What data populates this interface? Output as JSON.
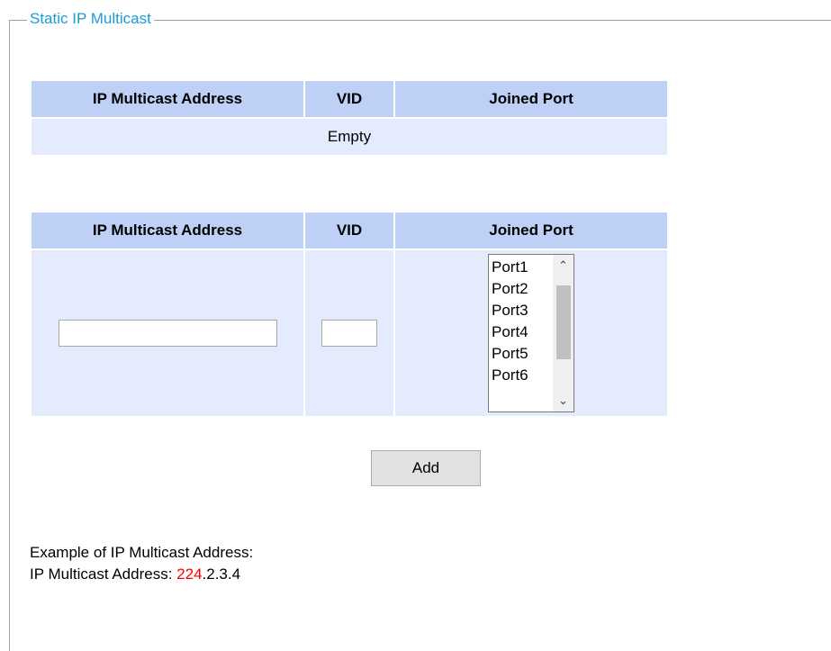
{
  "fieldset": {
    "legend": "Static IP Multicast"
  },
  "table1": {
    "headers": [
      "IP Multicast Address",
      "VID",
      "Joined Port"
    ],
    "empty_text": "Empty"
  },
  "table2": {
    "headers": [
      "IP Multicast Address",
      "VID",
      "Joined Port"
    ],
    "ip_input_value": "",
    "vid_input_value": "",
    "ports": [
      "Port1",
      "Port2",
      "Port3",
      "Port4",
      "Port5",
      "Port6"
    ]
  },
  "add_button": {
    "label": "Add"
  },
  "example": {
    "title": "Example of IP Multicast Address:",
    "prefix": "IP Multicast Address: ",
    "highlight": "224",
    "suffix": ".2.3.4",
    "highlight_color": "#ff0000"
  }
}
